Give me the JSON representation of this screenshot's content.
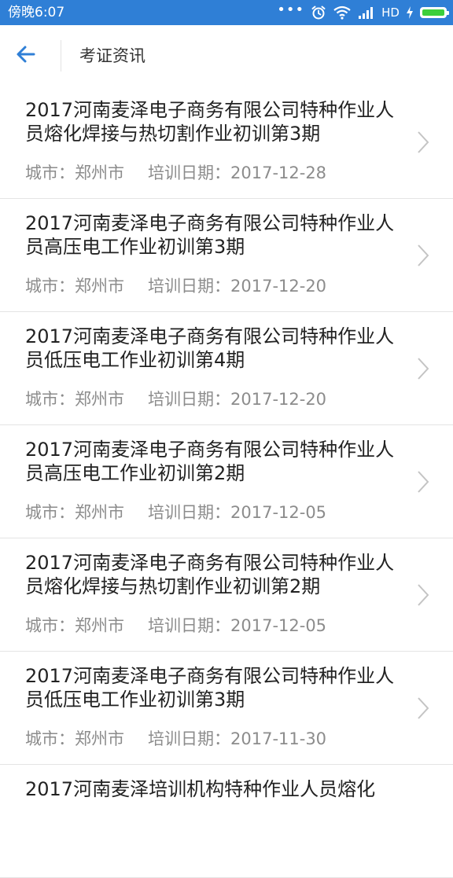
{
  "status_bar": {
    "time": "傍晚6:07",
    "network": "HD",
    "icons": [
      "more-dots-icon",
      "alarm-icon",
      "wifi-icon",
      "signal-icon",
      "charging-icon",
      "battery-icon"
    ],
    "background_color": "#2f7fd6"
  },
  "header": {
    "title": "考证资讯",
    "back_icon": "back-arrow-icon",
    "accent_color": "#2f7fd6"
  },
  "items": [
    {
      "title": "2017河南麦泽电子商务有限公司特种作业人员熔化焊接与热切割作业初训第3期",
      "city": "城市：郑州市",
      "date": "培训日期：2017-12-28"
    },
    {
      "title": "2017河南麦泽电子商务有限公司特种作业人员高压电工作业初训第3期",
      "city": "城市：郑州市",
      "date": "培训日期：2017-12-20"
    },
    {
      "title": "2017河南麦泽电子商务有限公司特种作业人员低压电工作业初训第4期",
      "city": "城市：郑州市",
      "date": "培训日期：2017-12-20"
    },
    {
      "title": "2017河南麦泽电子商务有限公司特种作业人员高压电工作业初训第2期",
      "city": "城市：郑州市",
      "date": "培训日期：2017-12-05"
    },
    {
      "title": "2017河南麦泽电子商务有限公司特种作业人员熔化焊接与热切割作业初训第2期",
      "city": "城市：郑州市",
      "date": "培训日期：2017-12-05"
    },
    {
      "title": "2017河南麦泽电子商务有限公司特种作业人员低压电工作业初训第3期",
      "city": "城市：郑州市",
      "date": "培训日期：2017-11-30"
    },
    {
      "title": "2017河南麦泽培训机构特种作业人员熔化",
      "city": "",
      "date": ""
    }
  ]
}
